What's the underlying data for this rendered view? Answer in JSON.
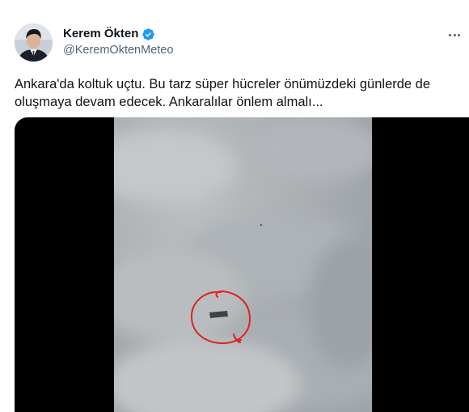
{
  "tweet": {
    "author": {
      "display_name": "Kerem Ökten",
      "handle": "@KeremOktenMeteo",
      "verified": true,
      "verified_color": "#1d9bf0"
    },
    "text": "Ankara'da koltuk uçtu. Bu tarz süper hücreler önümüzdeki günlerde de oluşmaya devam edecek. Ankaralılar önlem almalı...",
    "more_icon": "more-horizontal-icon",
    "media": {
      "type": "video",
      "annotation_color": "#e02020"
    }
  }
}
